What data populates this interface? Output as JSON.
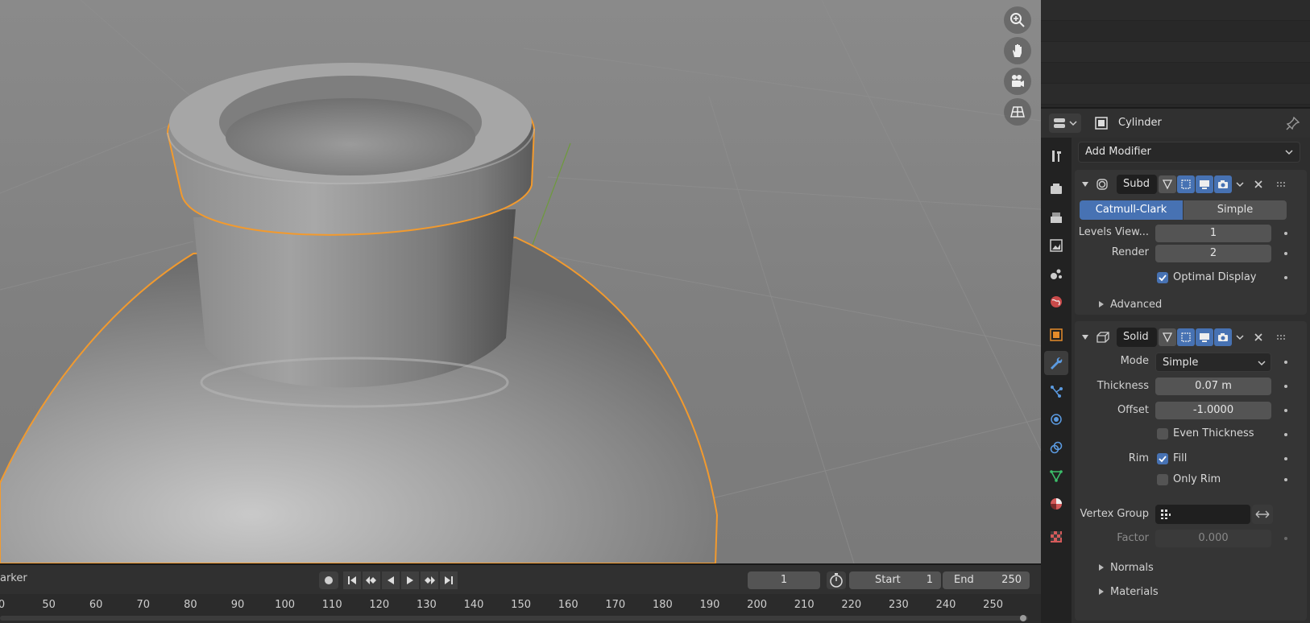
{
  "viewport": {
    "nav_icons": [
      "zoom-icon",
      "hand-pan-icon",
      "camera-icon",
      "grid-icon"
    ],
    "selection_color": "#f29a2e"
  },
  "timeline": {
    "marker_label": "arker",
    "current_frame": "1",
    "start_label": "Start",
    "start_value": "1",
    "end_label": "End",
    "end_value": "250",
    "ruler_ticks": [
      "0",
      "50",
      "60",
      "70",
      "80",
      "90",
      "100",
      "110",
      "120",
      "130",
      "140",
      "150",
      "160",
      "170",
      "180",
      "190",
      "200",
      "210",
      "220",
      "230",
      "240",
      "250"
    ]
  },
  "properties": {
    "object_name": "Cylinder",
    "add_modifier_label": "Add Modifier",
    "accent_color": "#4772b3",
    "subdivision": {
      "name": "Subd",
      "method_catmull": "Catmull-Clark",
      "method_simple": "Simple",
      "levels_viewport_label": "Levels View...",
      "levels_viewport_value": "1",
      "render_label": "Render",
      "render_value": "2",
      "optimal_display_label": "Optimal Display",
      "optimal_display_checked": true,
      "advanced_label": "Advanced"
    },
    "solidify": {
      "name": "Solid",
      "mode_label": "Mode",
      "mode_value": "Simple",
      "thickness_label": "Thickness",
      "thickness_value": "0.07 m",
      "offset_label": "Offset",
      "offset_value": "-1.0000",
      "even_thickness_label": "Even Thickness",
      "rim_label": "Rim",
      "fill_label": "Fill",
      "only_rim_label": "Only Rim",
      "vertex_group_label": "Vertex Group",
      "factor_label": "Factor",
      "factor_value": "0.000",
      "normals_label": "Normals",
      "materials_label": "Materials"
    }
  }
}
